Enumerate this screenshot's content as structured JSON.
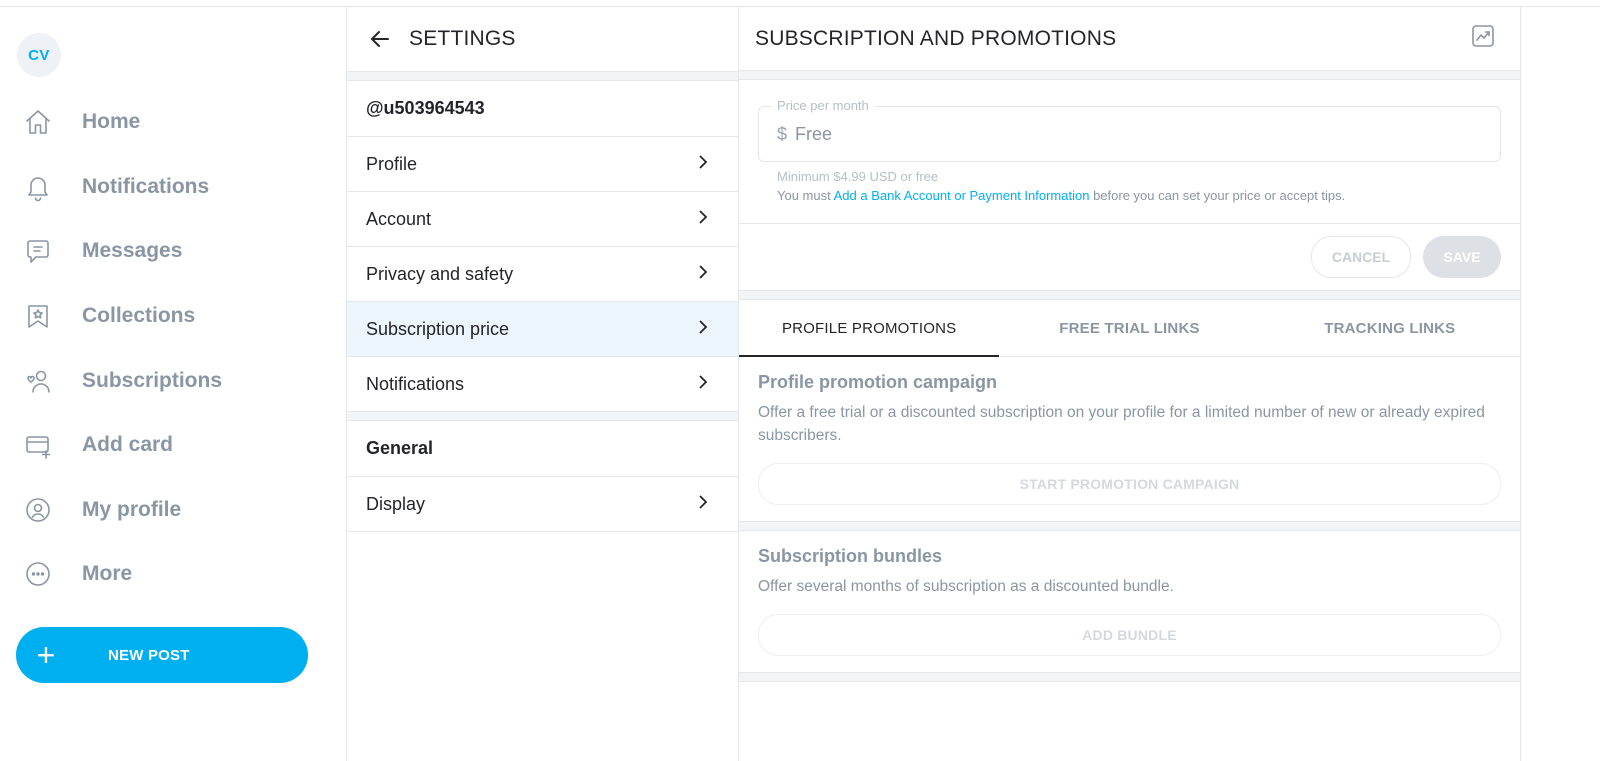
{
  "user": {
    "initials": "CV"
  },
  "nav": {
    "items": [
      {
        "label": "Home",
        "icon": "home-icon"
      },
      {
        "label": "Notifications",
        "icon": "bell-icon"
      },
      {
        "label": "Messages",
        "icon": "message-icon"
      },
      {
        "label": "Collections",
        "icon": "collections-icon"
      },
      {
        "label": "Subscriptions",
        "icon": "subscriptions-icon"
      },
      {
        "label": "Add card",
        "icon": "card-icon"
      },
      {
        "label": "My profile",
        "icon": "profile-icon"
      },
      {
        "label": "More",
        "icon": "more-icon"
      }
    ],
    "new_post": "NEW POST"
  },
  "settings": {
    "title": "SETTINGS",
    "username": "@u503964543",
    "items": [
      "Profile",
      "Account",
      "Privacy and safety",
      "Subscription price",
      "Notifications"
    ],
    "active_item": "Subscription price",
    "general_header": "General",
    "general_items": [
      "Display"
    ]
  },
  "main": {
    "title": "SUBSCRIPTION AND PROMOTIONS",
    "price": {
      "legend": "Price per month",
      "currency": "$",
      "placeholder": "Free",
      "minimum_hint": "Minimum $4.99 USD or free",
      "notice_prefix": "You must",
      "notice_link": "Add a Bank Account or Payment Information",
      "notice_suffix": "before you can set your price or accept tips."
    },
    "cancel": "CANCEL",
    "save": "SAVE",
    "tabs": [
      "PROFILE PROMOTIONS",
      "FREE TRIAL LINKS",
      "TRACKING LINKS"
    ],
    "active_tab": "PROFILE PROMOTIONS",
    "promotion": {
      "title": "Profile promotion campaign",
      "desc": "Offer a free trial or a discounted subscription on your profile for a limited number of new or already expired subscribers.",
      "button": "START PROMOTION CAMPAIGN"
    },
    "bundles": {
      "title": "Subscription bundles",
      "desc": "Offer several months of subscription as a discounted bundle.",
      "button": "ADD BUNDLE"
    }
  },
  "colors": {
    "accent": "#00aff0",
    "muted": "#8a96a3",
    "border": "#e4e6e9"
  }
}
